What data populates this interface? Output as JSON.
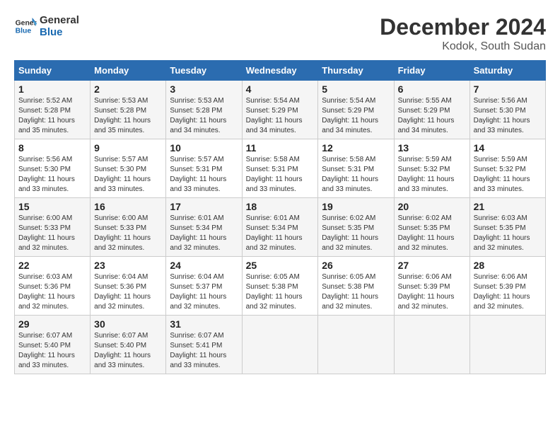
{
  "logo": {
    "line1": "General",
    "line2": "Blue"
  },
  "title": "December 2024",
  "location": "Kodok, South Sudan",
  "headers": [
    "Sunday",
    "Monday",
    "Tuesday",
    "Wednesday",
    "Thursday",
    "Friday",
    "Saturday"
  ],
  "weeks": [
    [
      {
        "day": "1",
        "sunrise": "5:52 AM",
        "sunset": "5:28 PM",
        "daylight": "11 hours and 35 minutes."
      },
      {
        "day": "2",
        "sunrise": "5:53 AM",
        "sunset": "5:28 PM",
        "daylight": "11 hours and 35 minutes."
      },
      {
        "day": "3",
        "sunrise": "5:53 AM",
        "sunset": "5:28 PM",
        "daylight": "11 hours and 34 minutes."
      },
      {
        "day": "4",
        "sunrise": "5:54 AM",
        "sunset": "5:29 PM",
        "daylight": "11 hours and 34 minutes."
      },
      {
        "day": "5",
        "sunrise": "5:54 AM",
        "sunset": "5:29 PM",
        "daylight": "11 hours and 34 minutes."
      },
      {
        "day": "6",
        "sunrise": "5:55 AM",
        "sunset": "5:29 PM",
        "daylight": "11 hours and 34 minutes."
      },
      {
        "day": "7",
        "sunrise": "5:56 AM",
        "sunset": "5:30 PM",
        "daylight": "11 hours and 33 minutes."
      }
    ],
    [
      {
        "day": "8",
        "sunrise": "5:56 AM",
        "sunset": "5:30 PM",
        "daylight": "11 hours and 33 minutes."
      },
      {
        "day": "9",
        "sunrise": "5:57 AM",
        "sunset": "5:30 PM",
        "daylight": "11 hours and 33 minutes."
      },
      {
        "day": "10",
        "sunrise": "5:57 AM",
        "sunset": "5:31 PM",
        "daylight": "11 hours and 33 minutes."
      },
      {
        "day": "11",
        "sunrise": "5:58 AM",
        "sunset": "5:31 PM",
        "daylight": "11 hours and 33 minutes."
      },
      {
        "day": "12",
        "sunrise": "5:58 AM",
        "sunset": "5:31 PM",
        "daylight": "11 hours and 33 minutes."
      },
      {
        "day": "13",
        "sunrise": "5:59 AM",
        "sunset": "5:32 PM",
        "daylight": "11 hours and 33 minutes."
      },
      {
        "day": "14",
        "sunrise": "5:59 AM",
        "sunset": "5:32 PM",
        "daylight": "11 hours and 33 minutes."
      }
    ],
    [
      {
        "day": "15",
        "sunrise": "6:00 AM",
        "sunset": "5:33 PM",
        "daylight": "11 hours and 32 minutes."
      },
      {
        "day": "16",
        "sunrise": "6:00 AM",
        "sunset": "5:33 PM",
        "daylight": "11 hours and 32 minutes."
      },
      {
        "day": "17",
        "sunrise": "6:01 AM",
        "sunset": "5:34 PM",
        "daylight": "11 hours and 32 minutes."
      },
      {
        "day": "18",
        "sunrise": "6:01 AM",
        "sunset": "5:34 PM",
        "daylight": "11 hours and 32 minutes."
      },
      {
        "day": "19",
        "sunrise": "6:02 AM",
        "sunset": "5:35 PM",
        "daylight": "11 hours and 32 minutes."
      },
      {
        "day": "20",
        "sunrise": "6:02 AM",
        "sunset": "5:35 PM",
        "daylight": "11 hours and 32 minutes."
      },
      {
        "day": "21",
        "sunrise": "6:03 AM",
        "sunset": "5:35 PM",
        "daylight": "11 hours and 32 minutes."
      }
    ],
    [
      {
        "day": "22",
        "sunrise": "6:03 AM",
        "sunset": "5:36 PM",
        "daylight": "11 hours and 32 minutes."
      },
      {
        "day": "23",
        "sunrise": "6:04 AM",
        "sunset": "5:36 PM",
        "daylight": "11 hours and 32 minutes."
      },
      {
        "day": "24",
        "sunrise": "6:04 AM",
        "sunset": "5:37 PM",
        "daylight": "11 hours and 32 minutes."
      },
      {
        "day": "25",
        "sunrise": "6:05 AM",
        "sunset": "5:38 PM",
        "daylight": "11 hours and 32 minutes."
      },
      {
        "day": "26",
        "sunrise": "6:05 AM",
        "sunset": "5:38 PM",
        "daylight": "11 hours and 32 minutes."
      },
      {
        "day": "27",
        "sunrise": "6:06 AM",
        "sunset": "5:39 PM",
        "daylight": "11 hours and 32 minutes."
      },
      {
        "day": "28",
        "sunrise": "6:06 AM",
        "sunset": "5:39 PM",
        "daylight": "11 hours and 32 minutes."
      }
    ],
    [
      {
        "day": "29",
        "sunrise": "6:07 AM",
        "sunset": "5:40 PM",
        "daylight": "11 hours and 33 minutes."
      },
      {
        "day": "30",
        "sunrise": "6:07 AM",
        "sunset": "5:40 PM",
        "daylight": "11 hours and 33 minutes."
      },
      {
        "day": "31",
        "sunrise": "6:07 AM",
        "sunset": "5:41 PM",
        "daylight": "11 hours and 33 minutes."
      },
      null,
      null,
      null,
      null
    ]
  ]
}
